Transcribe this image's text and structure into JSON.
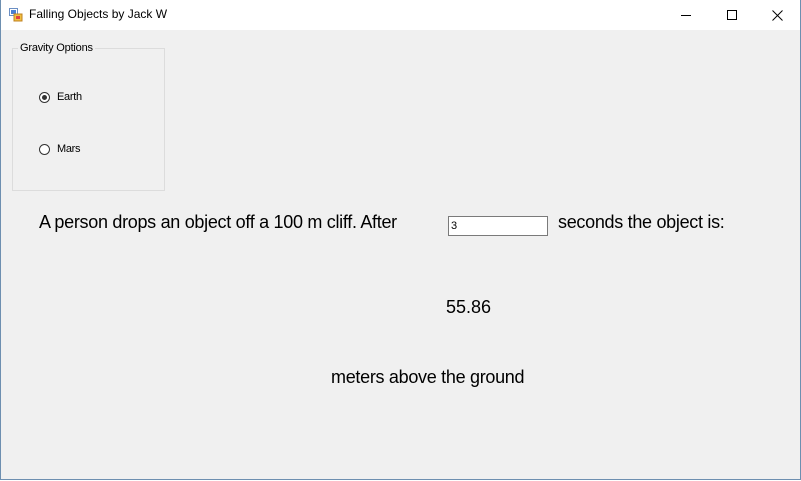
{
  "window": {
    "title": "Falling Objects by Jack W",
    "controls": {
      "minimize_icon": "minimize-icon",
      "maximize_icon": "maximize-icon",
      "close_icon": "close-icon"
    }
  },
  "gravity_options": {
    "legend": "Gravity Options",
    "options": [
      {
        "label": "Earth",
        "checked": true
      },
      {
        "label": "Mars",
        "checked": false
      }
    ]
  },
  "prompt": {
    "before_input": "A person drops an object off a 100 m cliff. After",
    "seconds_value": "3",
    "after_input": "seconds the object is:"
  },
  "result": {
    "value": "55.86",
    "caption": "meters above the ground"
  }
}
